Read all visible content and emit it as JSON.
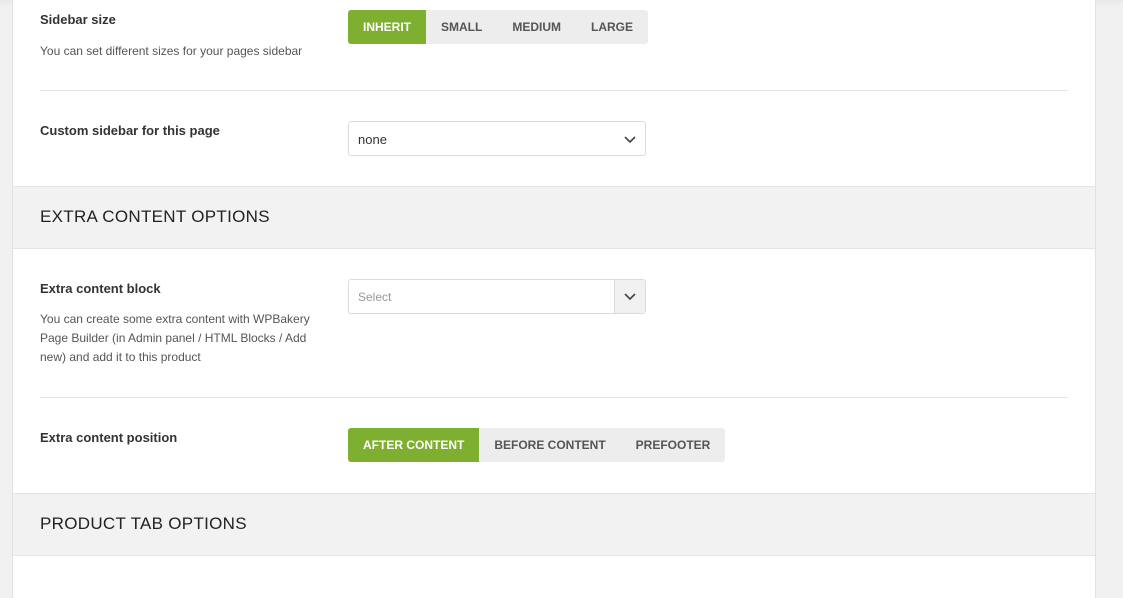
{
  "sidebar_size": {
    "label": "Sidebar size",
    "description": "You can set different sizes for your pages sidebar",
    "options": [
      "INHERIT",
      "SMALL",
      "MEDIUM",
      "LARGE"
    ],
    "selected": "INHERIT"
  },
  "custom_sidebar": {
    "label": "Custom sidebar for this page",
    "value": "none"
  },
  "extra_content_section": {
    "title": "EXTRA CONTENT OPTIONS"
  },
  "extra_content_block": {
    "label": "Extra content block",
    "placeholder": "Select",
    "description": "You can create some extra content with WPBakery Page Builder (in Admin panel / HTML Blocks / Add new) and add it to this product"
  },
  "extra_content_position": {
    "label": "Extra content position",
    "options": [
      "AFTER CONTENT",
      "BEFORE CONTENT",
      "PREFOOTER"
    ],
    "selected": "AFTER CONTENT"
  },
  "product_tab_section": {
    "title": "PRODUCT TAB OPTIONS"
  },
  "colors": {
    "accent": "#7eaf31",
    "section_bg": "#f2f2f2"
  }
}
